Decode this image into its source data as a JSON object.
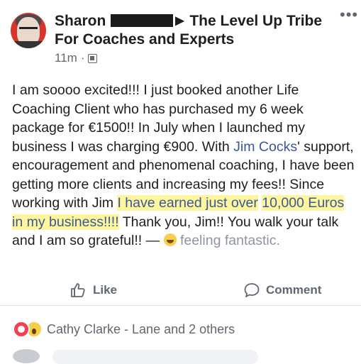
{
  "post": {
    "author": "Sharon",
    "group": "The Level Up Tribe For Coaches and Experts",
    "time": "11m",
    "body": {
      "p1": "I am soooo excited!!! I just booked another Life Coaching Client who has purchased my 6 week package for €1500!! In July when I launched my business I was charging €900. With ",
      "mention": "Jim Cocks",
      "p2": "' support, encouragement and phenomenal coaching, I have been getting more clients and increasing my fees!! Since working with Jim ",
      "highlight1": "I have earned just over",
      "highlight2": "10,000 Euros in my business!!!!",
      "p3": " Thank you, Jim!! You walk your talk and I am so grateful!! — ",
      "feeling": "feeling fantastic."
    }
  },
  "actions": {
    "like": "Like",
    "comment": "Comment"
  },
  "reactions": {
    "text": "Cathy Clarke - Lane and 2 others"
  },
  "icons": {
    "more": "more-options-icon",
    "like": "thumbs-up-icon",
    "comment": "speech-bubble-icon",
    "audience": "group-audience-icon"
  },
  "colors": {
    "link": "#385898",
    "muted": "#606770",
    "highlight": "#fff59d",
    "love": "#f33e58",
    "wow": "#f6cf4a"
  }
}
